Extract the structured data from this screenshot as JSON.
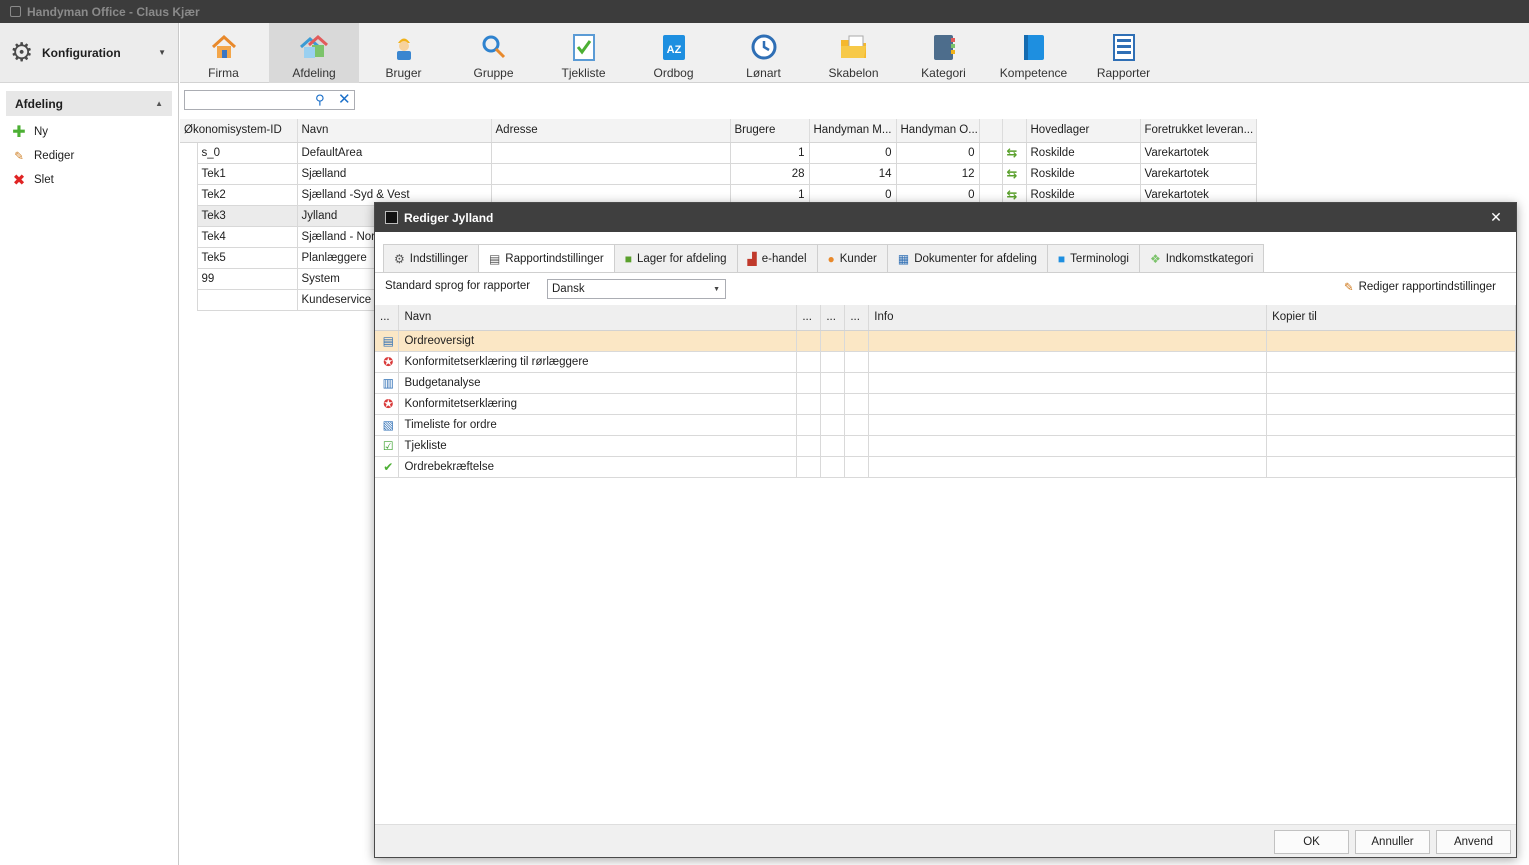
{
  "app": {
    "title": "Handyman Office - Claus Kjær"
  },
  "sidebar": {
    "config_label": "Konfiguration",
    "section_title": "Afdeling",
    "actions": [
      {
        "label": "Ny",
        "icon": "plus-icon"
      },
      {
        "label": "Rediger",
        "icon": "edit-icon"
      },
      {
        "label": "Slet",
        "icon": "delete-icon"
      }
    ]
  },
  "ribbon": {
    "buttons": [
      {
        "label": "Firma",
        "icon": "house-icon"
      },
      {
        "label": "Afdeling",
        "icon": "department-icon",
        "active": true
      },
      {
        "label": "Bruger",
        "icon": "worker-icon"
      },
      {
        "label": "Gruppe",
        "icon": "group-icon"
      },
      {
        "label": "Tjekliste",
        "icon": "checklist-icon"
      },
      {
        "label": "Ordbog",
        "icon": "dictionary-icon"
      },
      {
        "label": "Lønart",
        "icon": "clock-icon"
      },
      {
        "label": "Skabelon",
        "icon": "template-folder-icon"
      },
      {
        "label": "Kategori",
        "icon": "category-book-icon"
      },
      {
        "label": "Kompetence",
        "icon": "competence-book-icon"
      },
      {
        "label": "Rapporter",
        "icon": "reports-icon"
      }
    ]
  },
  "search": {
    "value": ""
  },
  "grid": {
    "columns": [
      "Økonomisystem-ID",
      "Navn",
      "Adresse",
      "Brugere",
      "Handyman M...",
      "Handyman O...",
      "",
      "",
      "Hovedlager",
      "Foretrukket leveran..."
    ],
    "rows": [
      {
        "id": "s_0",
        "name": "DefaultArea",
        "address": "",
        "users": "1",
        "hm": "0",
        "ho": "0",
        "warehouse": "Roskilde",
        "supplier": "Varekartotek"
      },
      {
        "id": "Tek1",
        "name": "Sjælland",
        "address": "",
        "users": "28",
        "hm": "14",
        "ho": "12",
        "warehouse": "Roskilde",
        "supplier": "Varekartotek"
      },
      {
        "id": "Tek2",
        "name": "Sjælland -Syd & Vest",
        "address": "",
        "users": "1",
        "hm": "0",
        "ho": "0",
        "warehouse": "Roskilde",
        "supplier": "Varekartotek"
      },
      {
        "id": "Tek3",
        "name": "Jylland",
        "selected": true
      },
      {
        "id": "Tek4",
        "name": "Sjælland - Nord"
      },
      {
        "id": "Tek5",
        "name": "Planlæggere"
      },
      {
        "id": "99",
        "name": "System"
      },
      {
        "id": "",
        "name": "Kundeservice"
      }
    ]
  },
  "dialog": {
    "title": "Rediger Jylland",
    "tabs": [
      {
        "label": "Indstillinger",
        "icon": "gear-icon"
      },
      {
        "label": "Rapportindstillinger",
        "icon": "printer-icon",
        "active": true
      },
      {
        "label": "Lager for afdeling",
        "icon": "truck-icon"
      },
      {
        "label": "e-handel",
        "icon": "factory-icon"
      },
      {
        "label": "Kunder",
        "icon": "person-icon"
      },
      {
        "label": "Dokumenter for afdeling",
        "icon": "documents-icon"
      },
      {
        "label": "Terminologi",
        "icon": "dictionary-icon"
      },
      {
        "label": "Indkomstkategori",
        "icon": "income-icon"
      }
    ],
    "language_label": "Standard sprog for rapporter",
    "language_value": "Dansk",
    "edit_reports_label": "Rediger rapportindstillinger",
    "report_columns": [
      "...",
      "Navn",
      "...",
      "...",
      "...",
      "Info",
      "Kopier til"
    ],
    "reports": [
      {
        "name": "Ordreoversigt",
        "icon": "order-overview-icon",
        "highlight": true
      },
      {
        "name": "Konformitetserklæring til rørlæggere",
        "icon": "ribbon-badge-icon"
      },
      {
        "name": "Budgetanalyse",
        "icon": "budget-icon"
      },
      {
        "name": "Konformitetserklæring",
        "icon": "ribbon-badge-icon"
      },
      {
        "name": "Timeliste for ordre",
        "icon": "timesheet-icon"
      },
      {
        "name": "Tjekliste",
        "icon": "checkbox-icon"
      },
      {
        "name": "Ordrebekræftelse",
        "icon": "check-circle-icon"
      }
    ],
    "buttons": {
      "ok": "OK",
      "cancel": "Annuller",
      "apply": "Anvend"
    },
    "close_glyph": "✕"
  },
  "colors": {
    "title_bar": "#3c3c3c",
    "dialog_title": "#3f3f3f",
    "highlight_row": "#fbe7c5",
    "accent_blue": "#1a6fc9",
    "green": "#5aa02c"
  }
}
